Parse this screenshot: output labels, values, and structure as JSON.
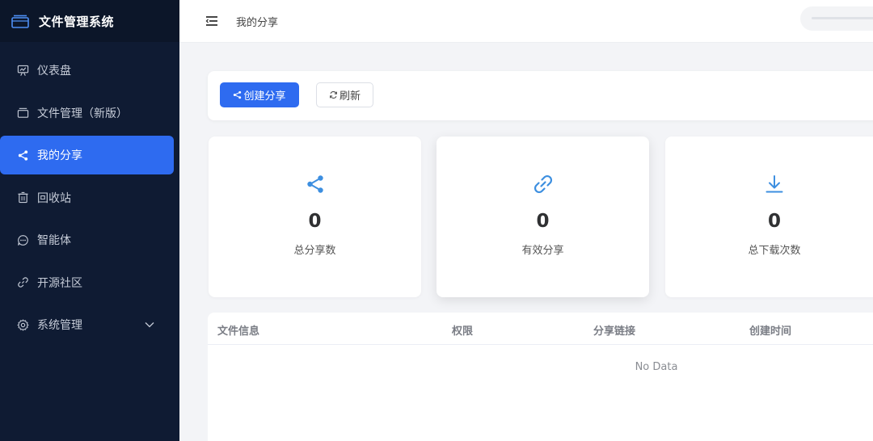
{
  "app": {
    "title": "文件管理系统"
  },
  "sidebar": {
    "items": [
      {
        "label": "仪表盘",
        "icon": "dashboard-icon",
        "active": false
      },
      {
        "label": "文件管理（新版）",
        "icon": "folder-icon",
        "active": false
      },
      {
        "label": "我的分享",
        "icon": "share-icon",
        "active": true
      },
      {
        "label": "回收站",
        "icon": "trash-icon",
        "active": false
      },
      {
        "label": "智能体",
        "icon": "chat-icon",
        "active": false
      },
      {
        "label": "开源社区",
        "icon": "link-icon",
        "active": false
      },
      {
        "label": "系统管理",
        "icon": "gear-icon",
        "active": false,
        "expandable": true
      }
    ]
  },
  "header": {
    "breadcrumb": "我的分享"
  },
  "toolbar": {
    "create_label": "创建分享",
    "refresh_label": "刷新"
  },
  "stats": [
    {
      "value": "0",
      "label": "总分享数",
      "icon": "share-icon"
    },
    {
      "value": "0",
      "label": "有效分享",
      "icon": "link-icon"
    },
    {
      "value": "0",
      "label": "总下载次数",
      "icon": "download-icon"
    }
  ],
  "table": {
    "columns": [
      "文件信息",
      "权限",
      "分享链接",
      "创建时间"
    ],
    "empty_text": "No Data"
  },
  "colors": {
    "accent": "#2e6bf0",
    "sidebar_bg": "#0f1b33",
    "stat_icon": "#3d8fe0"
  }
}
